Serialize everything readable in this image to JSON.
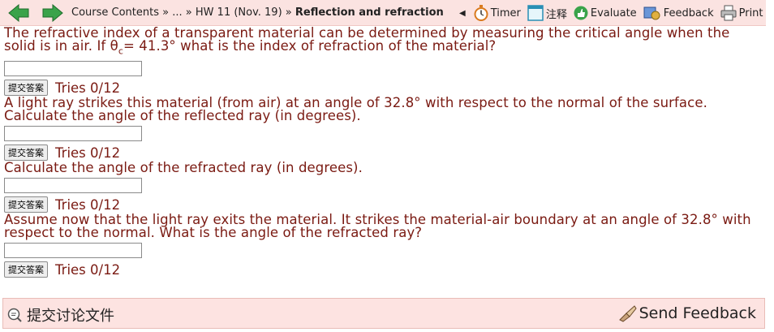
{
  "nav": {
    "breadcrumbs": [
      "Course Contents",
      "...",
      "HW 11 (Nov. 19)"
    ],
    "separator": "»",
    "current": "Reflection and refraction",
    "tools": {
      "timer": "Timer",
      "notes": "注释",
      "evaluate": "Evaluate",
      "feedback": "Feedback",
      "print": "Print"
    }
  },
  "questions": [
    {
      "text_before": "The refractive index of a transparent material can be determined by measuring the critical angle when the solid is in air. If θ",
      "subscript": "c",
      "text_after": "= 41.3° what is the index of refraction of the material?",
      "answer": "",
      "submit_label": "提交答案",
      "tries": "Tries 0/12"
    },
    {
      "text": "A light ray strikes this material (from air) at an angle of 32.8° with respect to the normal of the surface. Calculate the angle of the reflected ray (in degrees).",
      "answer": "",
      "submit_label": "提交答案",
      "tries": "Tries 0/12"
    },
    {
      "text": "Calculate the angle of the refracted ray (in degrees).",
      "answer": "",
      "submit_label": "提交答案",
      "tries": "Tries 0/12"
    },
    {
      "text": "Assume now that the light ray exits the material. It strikes the material-air boundary at an angle of 32.8° with respect to the normal. What is the angle of the refracted ray?",
      "answer": "",
      "submit_label": "提交答案",
      "tries": "Tries 0/12"
    }
  ],
  "footer": {
    "discussion": "提交讨论文件",
    "send_feedback": "Send Feedback"
  },
  "colors": {
    "text": "#7a1a12",
    "bar_bg": "#fbe3e1",
    "arrow": "#3aa34a"
  }
}
